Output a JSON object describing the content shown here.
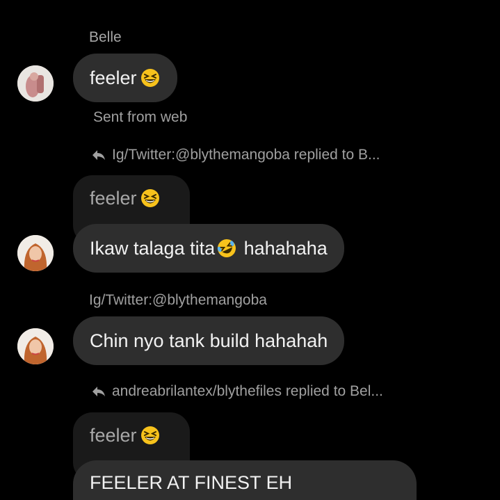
{
  "thread": {
    "sender_name": "Belle",
    "messages": [
      {
        "text": "feeler",
        "emoji": "grinning-squinting-face-icon",
        "meta": "Sent from web"
      },
      {
        "reply_header": "Ig/Twitter:@blythemangoba replied to B...",
        "quoted_text": "feeler",
        "quoted_emoji": "grinning-squinting-face-icon",
        "text": "Ikaw talaga tita",
        "emoji": "rolling-laughing-face-icon",
        "text_after": " hahahaha"
      },
      {
        "sender_label": "Ig/Twitter:@blythemangoba",
        "text": "Chin nyo tank build hahahah"
      },
      {
        "reply_header": "andreabrilantex/blythefiles replied to Bel...",
        "quoted_text": "feeler",
        "quoted_emoji": "grinning-squinting-face-icon",
        "text": "FEELER AT FINEST EH"
      }
    ]
  },
  "colors": {
    "background": "#000000",
    "bubble": "#2e2e2e",
    "quoted_bubble": "#1a1a1a",
    "text": "#f2f2f2",
    "meta_text": "#a0a0a0",
    "emoji_yellow": "#f7c21c"
  }
}
